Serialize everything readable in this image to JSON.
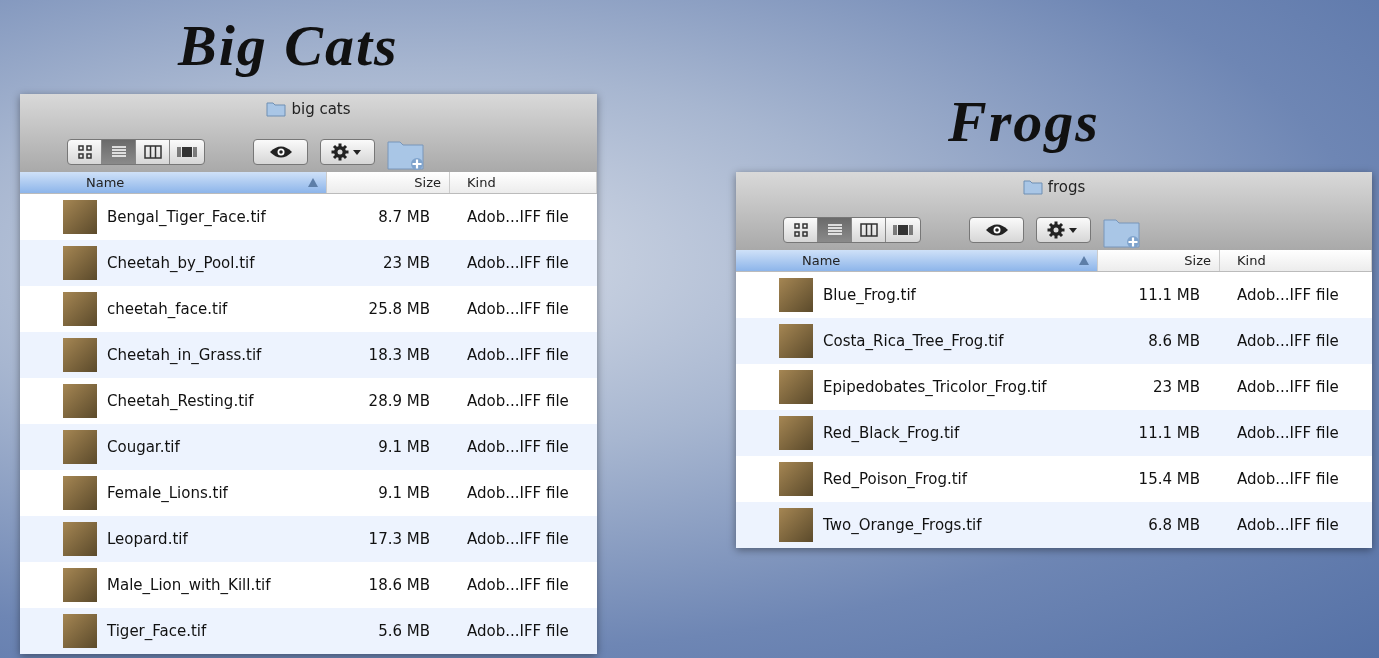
{
  "groups": [
    {
      "heading": "Big Cats",
      "window": {
        "title": "big cats",
        "view_modes": [
          {
            "kind": "icons",
            "selected": false
          },
          {
            "kind": "list",
            "selected": true
          },
          {
            "kind": "columns",
            "selected": false
          },
          {
            "kind": "coverflow",
            "selected": false
          }
        ],
        "columns": [
          {
            "label": "Name",
            "selected": true
          },
          {
            "label": "Size",
            "selected": false
          },
          {
            "label": "Kind",
            "selected": false
          }
        ],
        "rows": [
          {
            "name": "Bengal_Tiger_Face.tif",
            "size": "8.7 MB",
            "kind": "Adob...IFF file"
          },
          {
            "name": "Cheetah_by_Pool.tif",
            "size": "23 MB",
            "kind": "Adob...IFF file"
          },
          {
            "name": "cheetah_face.tif",
            "size": "25.8 MB",
            "kind": "Adob...IFF file"
          },
          {
            "name": "Cheetah_in_Grass.tif",
            "size": "18.3 MB",
            "kind": "Adob...IFF file"
          },
          {
            "name": "Cheetah_Resting.tif",
            "size": "28.9 MB",
            "kind": "Adob...IFF file"
          },
          {
            "name": "Cougar.tif",
            "size": "9.1 MB",
            "kind": "Adob...IFF file"
          },
          {
            "name": "Female_Lions.tif",
            "size": "9.1 MB",
            "kind": "Adob...IFF file"
          },
          {
            "name": "Leopard.tif",
            "size": "17.3 MB",
            "kind": "Adob...IFF file"
          },
          {
            "name": "Male_Lion_with_Kill.tif",
            "size": "18.6 MB",
            "kind": "Adob...IFF file"
          },
          {
            "name": "Tiger_Face.tif",
            "size": "5.6 MB",
            "kind": "Adob...IFF file"
          }
        ]
      }
    },
    {
      "heading": "Frogs",
      "window": {
        "title": "frogs",
        "view_modes": [
          {
            "kind": "icons",
            "selected": false
          },
          {
            "kind": "list",
            "selected": true
          },
          {
            "kind": "columns",
            "selected": false
          },
          {
            "kind": "coverflow",
            "selected": false
          }
        ],
        "columns": [
          {
            "label": "Name",
            "selected": true
          },
          {
            "label": "Size",
            "selected": false
          },
          {
            "label": "Kind",
            "selected": false
          }
        ],
        "rows": [
          {
            "name": "Blue_Frog.tif",
            "size": "11.1 MB",
            "kind": "Adob...IFF file"
          },
          {
            "name": "Costa_Rica_Tree_Frog.tif",
            "size": "8.6 MB",
            "kind": "Adob...IFF file"
          },
          {
            "name": "Epipedobates_Tricolor_Frog.tif",
            "size": "23 MB",
            "kind": "Adob...IFF file"
          },
          {
            "name": "Red_Black_Frog.tif",
            "size": "11.1 MB",
            "kind": "Adob...IFF file"
          },
          {
            "name": "Red_Poison_Frog.tif",
            "size": "15.4 MB",
            "kind": "Adob...IFF file"
          },
          {
            "name": "Two_Orange_Frogs.tif",
            "size": "6.8 MB",
            "kind": "Adob...IFF file"
          }
        ]
      }
    }
  ]
}
